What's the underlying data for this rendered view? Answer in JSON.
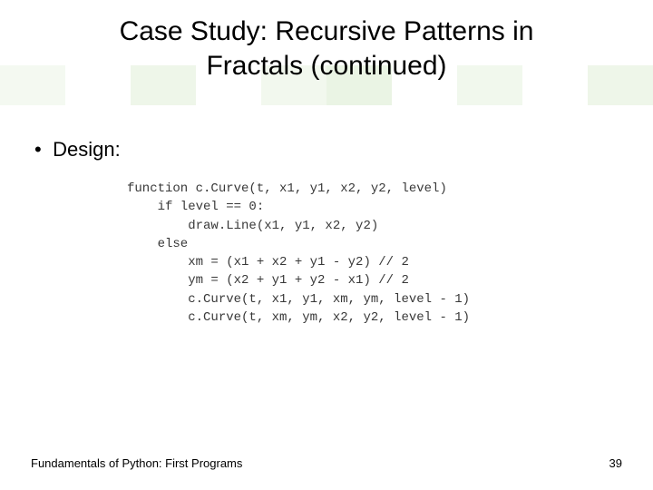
{
  "title": {
    "line1": "Case Study: Recursive Patterns in",
    "line2": "Fractals (continued)"
  },
  "bullet_label": "Design:",
  "code": {
    "l1": "function c.Curve(t, x1, y1, x2, y2, level)",
    "l2": "    if level == 0:",
    "l3": "        draw.Line(x1, y1, x2, y2)",
    "l4": "    else",
    "l5": "        xm = (x1 + x2 + y1 - y2) // 2",
    "l6": "        ym = (x2 + y1 + y2 - x1) // 2",
    "l7": "        c.Curve(t, x1, y1, xm, ym, level - 1)",
    "l8": "        c.Curve(t, xm, ym, x2, y2, level - 1)"
  },
  "footer": {
    "left": "Fundamentals of Python: First Programs",
    "page": "39"
  }
}
